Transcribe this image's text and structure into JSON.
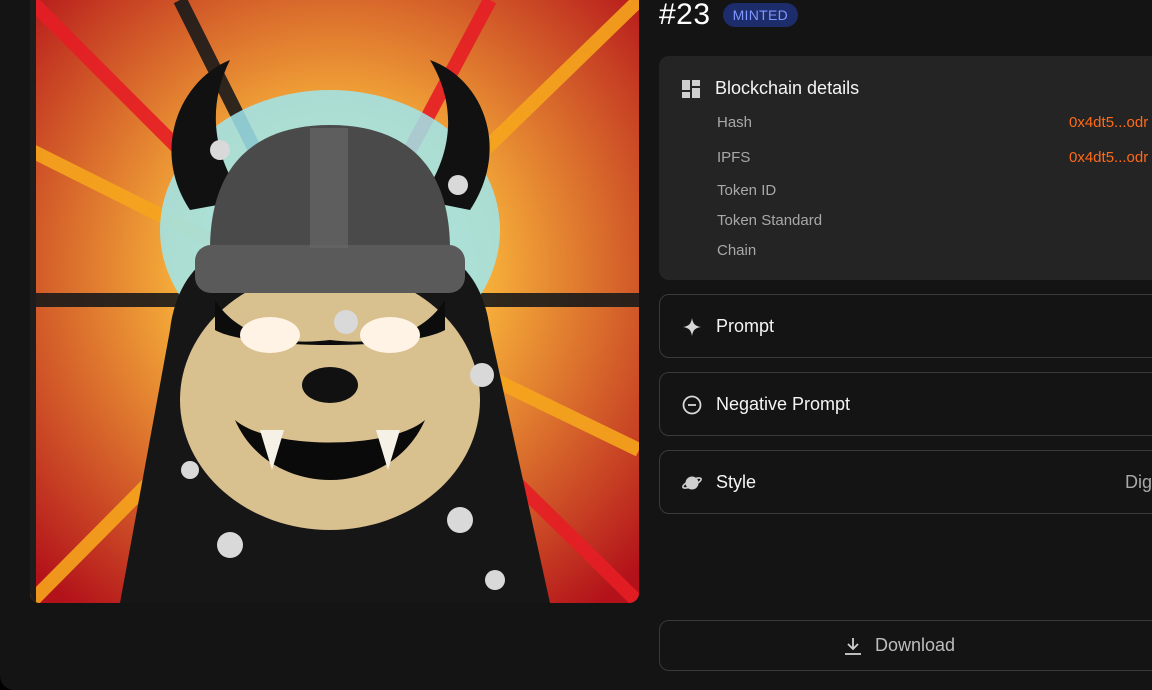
{
  "header": {
    "title": "#23",
    "badge": "MINTED"
  },
  "artwork": {
    "alt": "angry bear warrior with horned helmet"
  },
  "blockchain": {
    "title": "Blockchain details",
    "icon": "dashboard-grid-icon",
    "rows": [
      {
        "label": "Hash",
        "value": "0x4dt5...odr"
      },
      {
        "label": "IPFS",
        "value": "0x4dt5...odr"
      },
      {
        "label": "Token ID",
        "value": ""
      },
      {
        "label": "Token Standard",
        "value": ""
      },
      {
        "label": "Chain",
        "value": ""
      }
    ]
  },
  "sections": {
    "prompt": {
      "label": "Prompt",
      "icon": "sparkle-icon"
    },
    "negative": {
      "label": "Negative Prompt",
      "icon": "minus-circle-icon"
    },
    "style": {
      "label": "Style",
      "value": "Dig",
      "icon": "planet-icon"
    }
  },
  "download": {
    "label": "Download",
    "icon": "download-icon"
  },
  "colors": {
    "accent": "#ff6a1a",
    "badge_bg": "#1d2c6b",
    "badge_text": "#7f97ff"
  }
}
